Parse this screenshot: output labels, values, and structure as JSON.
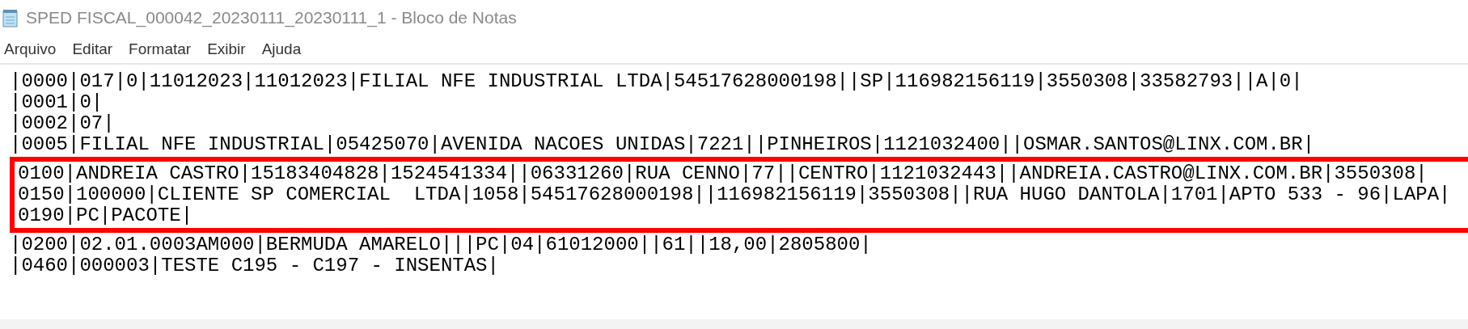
{
  "window": {
    "title": "SPED FISCAL_000042_20230111_20230111_1 - Bloco de Notas"
  },
  "menu": [
    "Arquivo",
    "Editar",
    "Formatar",
    "Exibir",
    "Ajuda"
  ],
  "editor": {
    "blocks": [
      {
        "highlighted": false,
        "lines": [
          "|0000|017|0|11012023|11012023|FILIAL NFE INDUSTRIAL LTDA|54517628000198||SP|116982156119|3550308|33582793||A|0|",
          "|0001|0|",
          "|0002|07|",
          "|0005|FILIAL NFE INDUSTRIAL|05425070|AVENIDA NACOES UNIDAS|7221||PINHEIROS|1121032400||OSMAR.SANTOS@LINX.COM.BR|"
        ]
      },
      {
        "highlighted": true,
        "lines": [
          "0100|ANDREIA CASTRO|15183404828|1524541334||06331260|RUA CENNO|77||CENTRO|1121032443||ANDREIA.CASTRO@LINX.COM.BR|3550308|",
          "0150|100000|CLIENTE SP COMERCIAL  LTDA|1058|54517628000198||116982156119|3550308||RUA HUGO DANTOLA|1701|APTO 533 - 96|LAPA|",
          "0190|PC|PACOTE|"
        ]
      },
      {
        "highlighted": false,
        "lines": [
          "|0200|02.01.0003AM000|BERMUDA AMARELO|||PC|04|61012000||61||18,00|2805800|",
          "|0460|000003|TESTE C195 - C197 - INSENTAS|"
        ]
      }
    ]
  }
}
